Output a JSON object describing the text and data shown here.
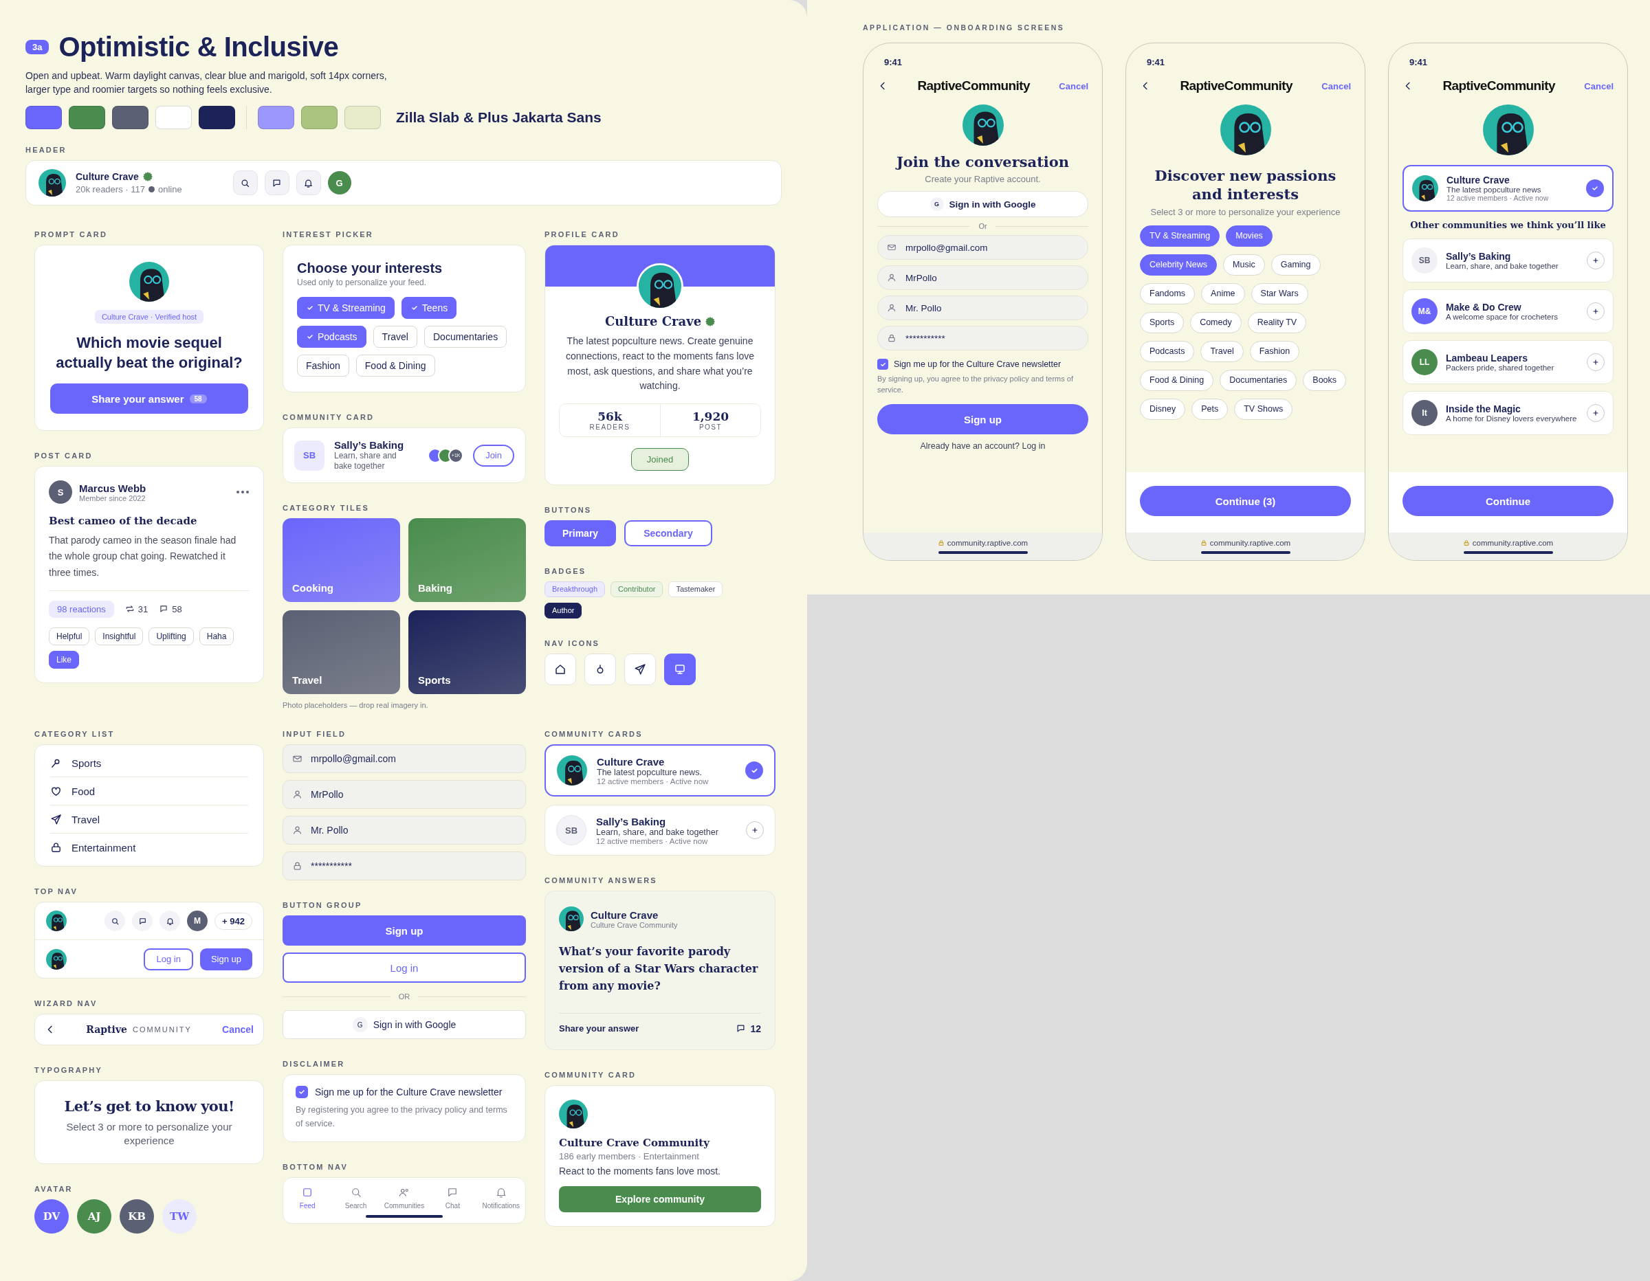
{
  "intro": {
    "badge": "3a",
    "title": "Optimistic & Inclusive",
    "description": "Open and upbeat. Warm daylight canvas, clear blue and marigold, soft 14px corners, larger type and roomier targets so nothing feels exclusive.",
    "swatches": [
      {
        "color": "#6b66fb"
      },
      {
        "color": "#4a8c4e"
      },
      {
        "color": "#5b6074"
      },
      {
        "color": "#ffffff"
      },
      {
        "color": "#1c2359"
      }
    ],
    "tint_swatches": [
      {
        "color": "#9b97fc"
      },
      {
        "color": "#a8c47f"
      },
      {
        "color": "#e9eccb"
      }
    ],
    "font_pairing": "Zilla Slab & Plus Jakarta Sans"
  },
  "header_bar": {
    "label": "HEADER",
    "name": "Culture Crave",
    "readers": "20k readers · 117",
    "online": "online",
    "avatar_initial": "G"
  },
  "prompt_card": {
    "label": "PROMPT CARD",
    "host": "Culture Crave · Verified host",
    "question": "Which movie sequel actually beat the original?",
    "button": "Share your answer",
    "count": "58"
  },
  "post_card": {
    "label": "POST CARD",
    "avatar_initial": "S",
    "author": "Marcus Webb",
    "meta": "Member since 2022",
    "title": "Best cameo of the decade",
    "body": "That parody cameo in the season finale had the whole group chat going. Rewatched it three times.",
    "reactions": "98 reactions",
    "reposts": "31",
    "comments": "58",
    "tags": [
      {
        "label": "Helpful",
        "selected": false
      },
      {
        "label": "Insightful",
        "selected": false
      },
      {
        "label": "Uplifting",
        "selected": false
      },
      {
        "label": "Haha",
        "selected": false
      },
      {
        "label": "Like",
        "selected": true
      }
    ]
  },
  "interest_picker": {
    "label": "INTEREST PICKER",
    "title": "Choose your interests",
    "subtitle": "Used only to personalize your feed.",
    "chips": [
      {
        "label": "TV & Streaming",
        "selected": true
      },
      {
        "label": "Teens",
        "selected": true
      },
      {
        "label": "Podcasts",
        "selected": true
      },
      {
        "label": "Travel",
        "selected": false
      },
      {
        "label": "Documentaries",
        "selected": false
      },
      {
        "label": "Fashion",
        "selected": false
      },
      {
        "label": "Food & Dining",
        "selected": false
      }
    ]
  },
  "community_card": {
    "label": "COMMUNITY CARD",
    "initials": "SB",
    "name": "Sally’s Baking",
    "description": "Learn, share and bake together",
    "member_count": "+1K",
    "button": "Join"
  },
  "category_tiles": {
    "label": "CATEGORY TILES",
    "tiles": [
      {
        "label": "Cooking",
        "color": "#6b66fb"
      },
      {
        "label": "Baking",
        "color": "#4a8c4e"
      },
      {
        "label": "Travel",
        "color": "#5b6074"
      },
      {
        "label": "Sports",
        "color": "#1c2359"
      }
    ],
    "note": "Photo placeholders — drop real imagery in."
  },
  "profile_card": {
    "label": "PROFILE CARD",
    "name": "Culture Crave",
    "bio": "The latest popculture news. Create genuine connections, react to the moments fans love most, ask questions, and share what you’re watching.",
    "stats": [
      {
        "value": "56k",
        "label": "READERS"
      },
      {
        "value": "1,920",
        "label": "POST"
      }
    ],
    "button": "Joined"
  },
  "buttons": {
    "label": "BUTTONS",
    "items": [
      {
        "label": "Primary",
        "kind": "primary"
      },
      {
        "label": "Secondary",
        "kind": "secondary"
      }
    ]
  },
  "badges": {
    "label": "BADGES",
    "items": [
      {
        "label": "Breakthrough",
        "kind": "accent"
      },
      {
        "label": "Contributor",
        "kind": "success"
      },
      {
        "label": "Tastemaker",
        "kind": "neutral"
      },
      {
        "label": "Author",
        "kind": "dark"
      }
    ]
  },
  "nav_icons": {
    "label": "NAV ICONS",
    "items": [
      {
        "selected": false
      },
      {
        "selected": false
      },
      {
        "selected": false
      },
      {
        "selected": true
      }
    ]
  },
  "category_list": {
    "label": "CATEGORY LIST",
    "items": [
      "Sports",
      "Food",
      "Travel",
      "Entertainment"
    ]
  },
  "top_nav": {
    "label": "TOP NAV",
    "avatar_initial": "M",
    "count": "+ 942",
    "login": "Log in",
    "signup": "Sign up"
  },
  "wizard_nav": {
    "label": "WIZARD NAV",
    "brand": "Raptive",
    "brand_suffix": "COMMUNITY",
    "cancel": "Cancel"
  },
  "typography": {
    "label": "TYPOGRAPHY",
    "heading": "Let’s get to know you!",
    "body": "Select 3 or more to personalize your experience"
  },
  "avatars": {
    "label": "AVATAR",
    "items": [
      {
        "initials": "DV",
        "color": "#6b66fb"
      },
      {
        "initials": "AJ",
        "color": "#4a8c4e"
      },
      {
        "initials": "KB",
        "color": "#5b6074"
      },
      {
        "initials": "TW",
        "color": "#ecebfd"
      }
    ]
  },
  "input_fields": {
    "label": "INPUT FIELD",
    "fields": [
      {
        "kind": "email",
        "value": "mrpollo@gmail.com"
      },
      {
        "kind": "user",
        "value": "MrPollo"
      },
      {
        "kind": "user",
        "value": "Mr. Pollo"
      },
      {
        "kind": "password",
        "value": "***********"
      }
    ]
  },
  "button_group": {
    "label": "BUTTON GROUP",
    "primary": "Sign up",
    "secondary": "Log in",
    "divider": "OR",
    "google_mark": "G",
    "google": "Sign in with Google"
  },
  "disclaimer": {
    "label": "DISCLAIMER",
    "checked": true,
    "text": "Sign me up for the Culture Crave newsletter",
    "terms": "By registering you agree to the privacy policy and terms of service."
  },
  "bottom_nav": {
    "label": "BOTTOM NAV",
    "items": [
      {
        "label": "Feed",
        "selected": true
      },
      {
        "label": "Search",
        "selected": false
      },
      {
        "label": "Communities",
        "selected": false
      },
      {
        "label": "Chat",
        "selected": false
      },
      {
        "label": "Notifications",
        "selected": false
      }
    ]
  },
  "community_cards": {
    "label": "COMMUNITY CARDS",
    "items": [
      {
        "kind": "image",
        "name": "Culture Crave",
        "description": "The latest popculture news.",
        "meta": "12 active members · Active now",
        "selected": true
      },
      {
        "kind": "initials",
        "initials": "SB",
        "name": "Sally’s Baking",
        "description": "Learn, share, and bake together",
        "meta": "12 active members · Active now",
        "selected": false
      }
    ]
  },
  "community_answers": {
    "label": "COMMUNITY ANSWERS",
    "name": "Culture Crave",
    "community": "Culture Crave Community",
    "question": "What’s your favorite parody version of a Star Wars character from any movie?",
    "action": "Share your answer",
    "count": "12"
  },
  "community_card_large": {
    "label": "COMMUNITY CARD",
    "name": "Culture Crave Community",
    "meta": "186 early members · Entertainment",
    "description": "React to the moments fans love most.",
    "button": "Explore community"
  },
  "onboarding": {
    "label": "APPLICATION — ONBOARDING SCREENS",
    "screens": [
      {
        "kind": "signup",
        "time": "9:41",
        "logo": "RaptiveCommunity",
        "cancel": "Cancel",
        "title": "Join the conversation",
        "subtitle": "Create your Raptive account.",
        "google_mark": "G",
        "google": "Sign in with Google",
        "divider": "Or",
        "fields": [
          {
            "kind": "email",
            "value": "mrpollo@gmail.com"
          },
          {
            "kind": "user",
            "value": "MrPollo"
          },
          {
            "kind": "user",
            "value": "Mr. Pollo"
          },
          {
            "kind": "password",
            "value": "***********"
          }
        ],
        "newsletter_checked": true,
        "newsletter": "Sign me up for the Culture Crave newsletter",
        "terms": "By signing up, you agree to the privacy policy and terms of service.",
        "button": "Sign up",
        "footer": "Already have an account? Log in",
        "url": "community.raptive.com"
      },
      {
        "kind": "interests",
        "time": "9:41",
        "logo": "RaptiveCommunity",
        "cancel": "Cancel",
        "title": "Discover new passions and interests",
        "subtitle": "Select 3 or more to personalize your experience",
        "chips": [
          {
            "label": "TV & Streaming",
            "selected": true
          },
          {
            "label": "Movies",
            "selected": true
          },
          {
            "label": "Celebrity News",
            "selected": true
          },
          {
            "label": "Music",
            "selected": false
          },
          {
            "label": "Gaming",
            "selected": false
          },
          {
            "label": "Fandoms",
            "selected": false
          },
          {
            "label": "Anime",
            "selected": false
          },
          {
            "label": "Star Wars",
            "selected": false
          },
          {
            "label": "Sports",
            "selected": false
          },
          {
            "label": "Comedy",
            "selected": false
          },
          {
            "label": "Reality TV",
            "selected": false
          },
          {
            "label": "Podcasts",
            "selected": false
          },
          {
            "label": "Travel",
            "selected": false
          },
          {
            "label": "Fashion",
            "selected": false
          },
          {
            "label": "Food & Dining",
            "selected": false
          },
          {
            "label": "Documentaries",
            "selected": false
          },
          {
            "label": "Books",
            "selected": false
          },
          {
            "label": "Disney",
            "selected": false
          },
          {
            "label": "Pets",
            "selected": false
          },
          {
            "label": "TV Shows",
            "selected": false
          }
        ],
        "button": "Continue (3)",
        "url": "community.raptive.com"
      },
      {
        "kind": "communities",
        "time": "9:41",
        "logo": "RaptiveCommunity",
        "cancel": "Cancel",
        "featured": {
          "name": "Culture Crave",
          "description": "The latest popculture news",
          "meta": "12 active members · Active now",
          "selected": true
        },
        "heading": "Other communities we think you’ll like",
        "communities": [
          {
            "initials": "SB",
            "name": "Sally’s Baking",
            "description": "Learn, share, and bake together",
            "color": "#f1f1f5"
          },
          {
            "initials": "M&",
            "name": "Make & Do Crew",
            "description": "A welcome space for crocheters",
            "color": "#6b66fb"
          },
          {
            "initials": "LL",
            "name": "Lambeau Leapers",
            "description": "Packers pride, shared together",
            "color": "#4a8c4e"
          },
          {
            "initials": "It",
            "name": "Inside the Magic",
            "description": "A home for Disney lovers everywhere",
            "color": "#5b6074"
          }
        ],
        "button": "Continue",
        "url": "community.raptive.com"
      }
    ]
  }
}
